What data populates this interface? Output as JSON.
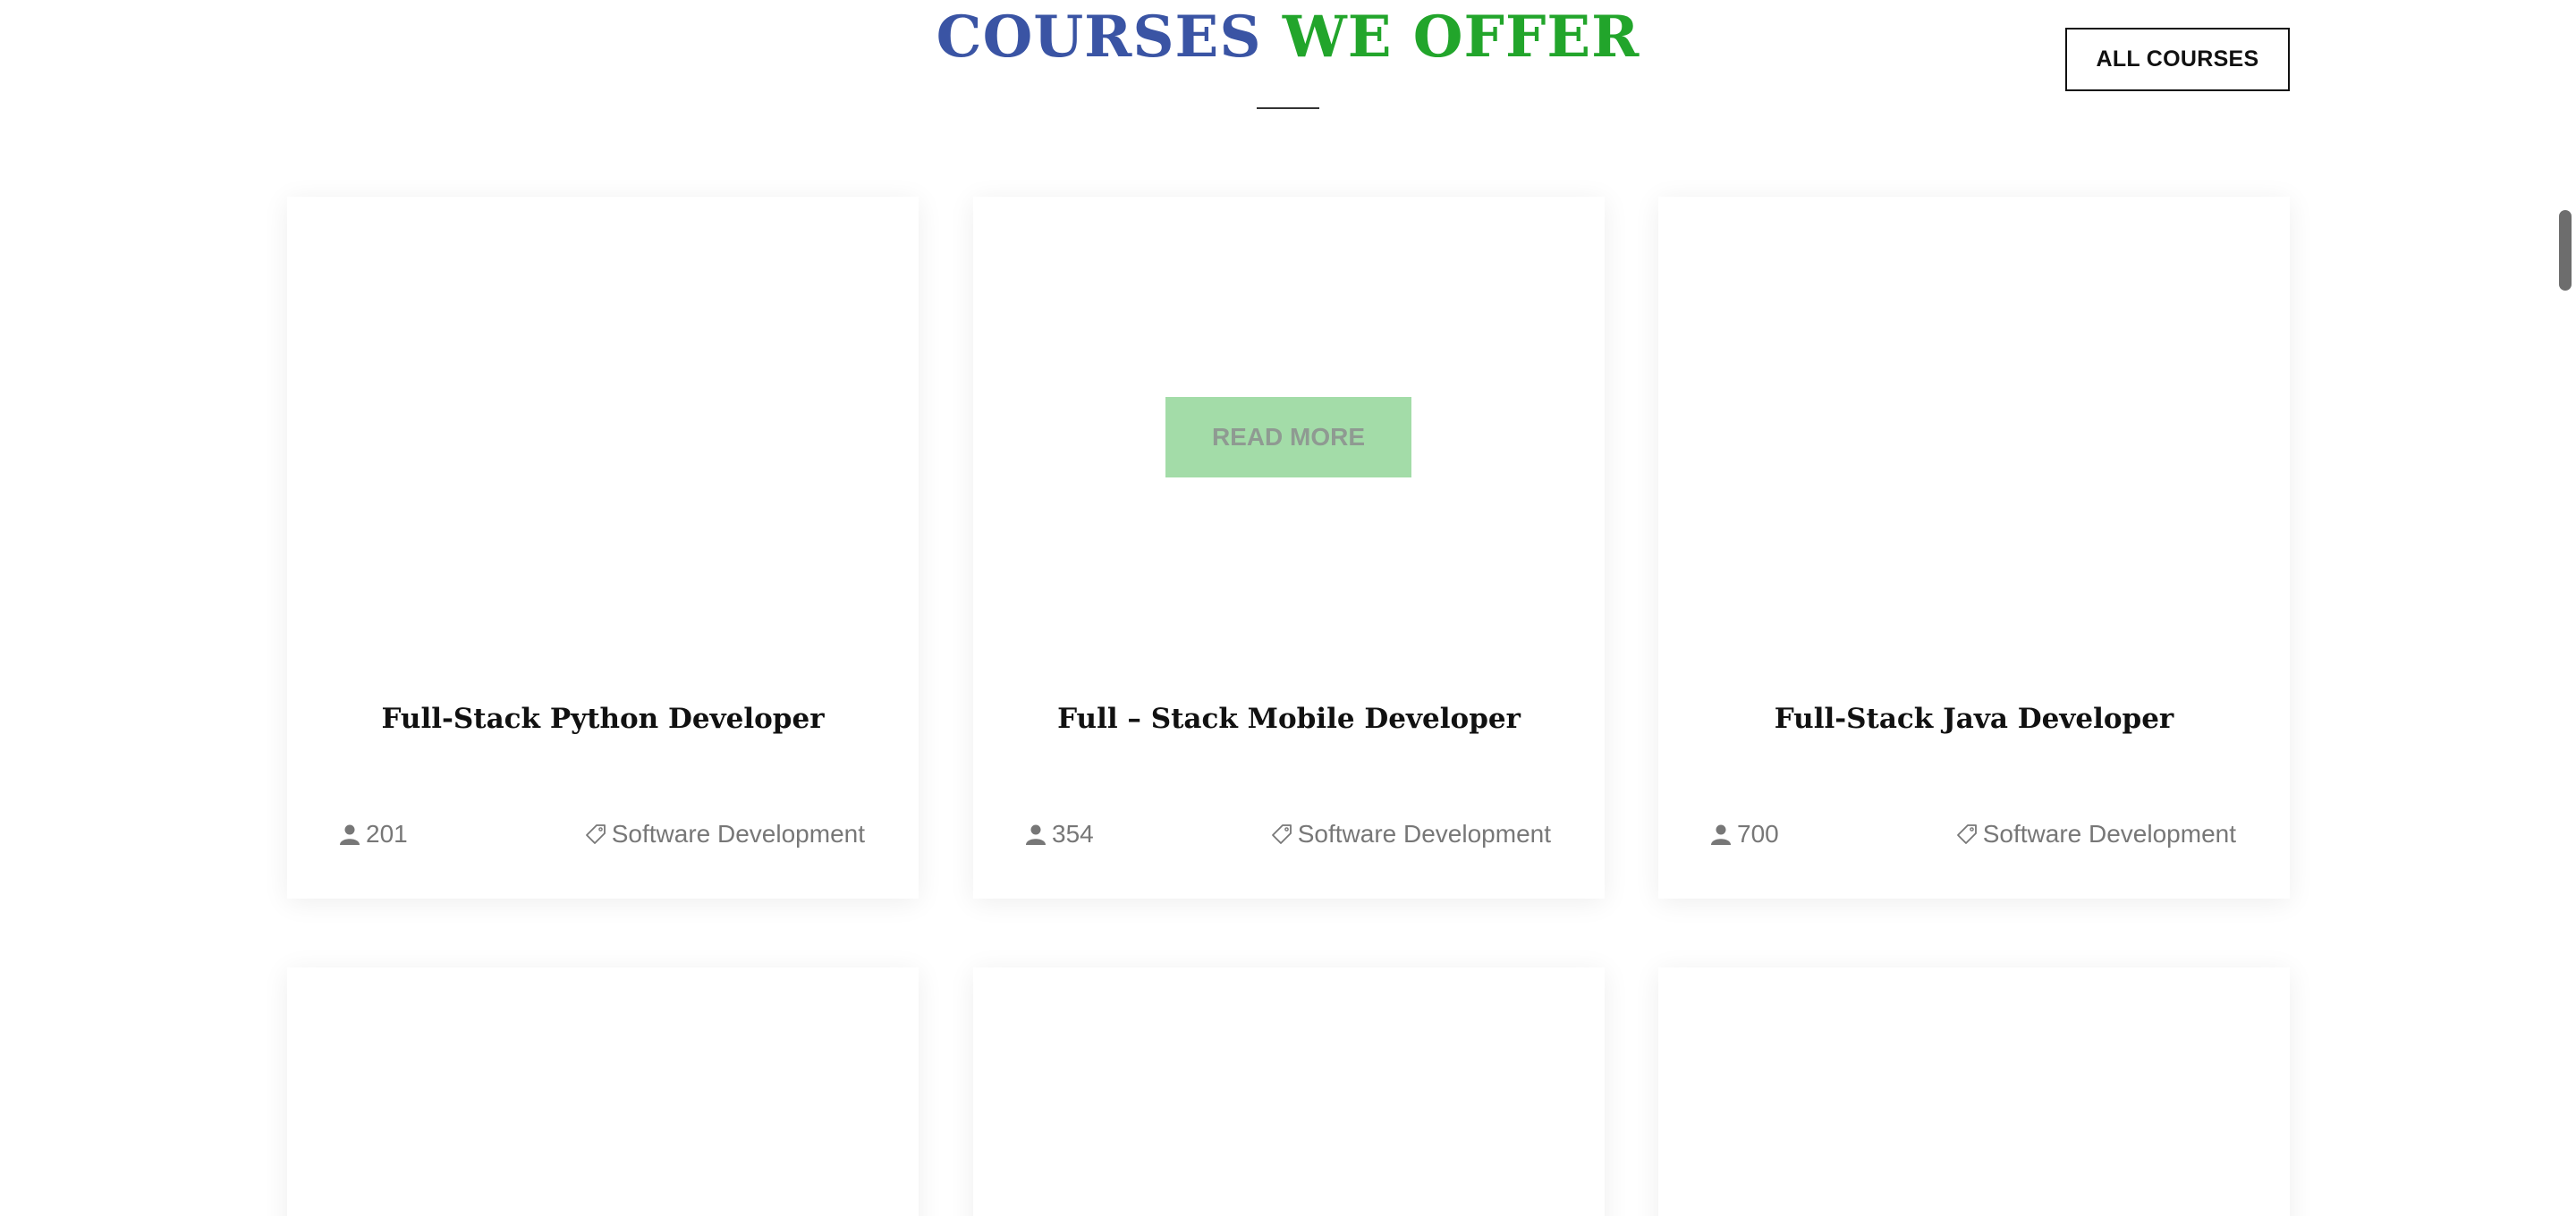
{
  "section": {
    "title_part1": "COURSES",
    "title_part2": "WE OFFER",
    "colors": {
      "title_blue": "#3a54a4",
      "title_green": "#22a52b",
      "read_more_bg": "#a3dca8"
    }
  },
  "header": {
    "all_courses_label": "ALL COURSES"
  },
  "courses": [
    {
      "title": "Full-Stack Python Developer",
      "students": "201",
      "category": "Software Development",
      "students_icon": "user-icon",
      "category_icon": "tag-icon"
    },
    {
      "title": "Full – Stack Mobile Developer",
      "students": "354",
      "category": "Software Development",
      "read_more_label": "READ MORE",
      "students_icon": "user-icon",
      "category_icon": "tag-icon"
    },
    {
      "title": "Full-Stack Java Developer",
      "students": "700",
      "category": "Software Development",
      "students_icon": "user-icon",
      "category_icon": "tag-icon"
    }
  ]
}
